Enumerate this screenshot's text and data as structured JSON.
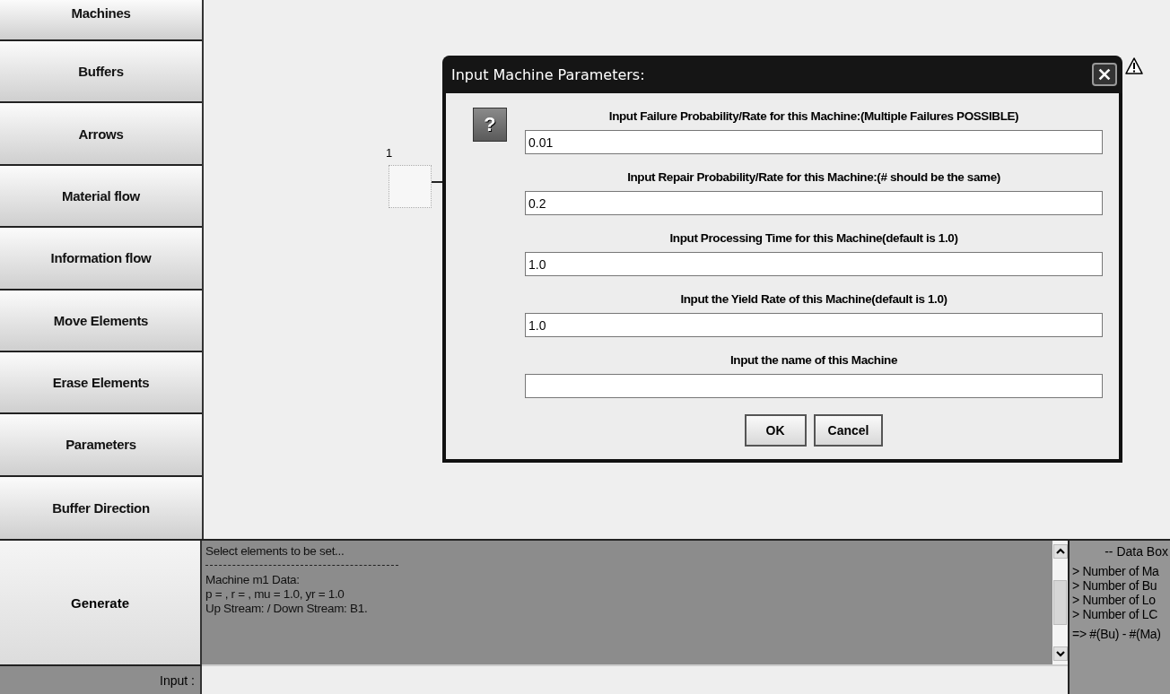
{
  "sidebar": {
    "buttons": [
      "Machines",
      "Buffers",
      "Arrows",
      "Material flow",
      "Information flow",
      "Move Elements",
      "Erase Elements",
      "Parameters",
      "Buffer Direction"
    ]
  },
  "canvas": {
    "machine": {
      "label": "1"
    }
  },
  "dialog": {
    "title": "Input Machine Parameters:",
    "icon": "?",
    "fields": [
      {
        "label": "Input Failure Probability/Rate for this Machine:(Multiple Failures POSSIBLE)",
        "value": "0.01"
      },
      {
        "label": "Input Repair Probability/Rate for this Machine:(# should be the same)",
        "value": "0.2"
      },
      {
        "label": "Input Processing Time for this Machine(default is 1.0)",
        "value": "1.0"
      },
      {
        "label": "Input the Yield Rate of this Machine(default is 1.0)",
        "value": "1.0"
      },
      {
        "label": "Input the name of this Machine"
      }
    ],
    "buttons": [
      "OK",
      "Cancel"
    ]
  },
  "generate_button": "Generate",
  "log": {
    "lines": [
      "Select elements to be set...",
      "Machine m1 Data:",
      "p = , r = , mu = 1.0, yr = 1.0",
      "Up Stream:   /  Down Stream: B1."
    ]
  },
  "input": {
    "label": "Input :"
  },
  "data_box": {
    "title": "-- Data Box",
    "lines": [
      "> Number of Ma",
      "> Number of Bu",
      "> Number of Lo",
      "> Number of LC",
      "=> #(Bu) - #(Ma)"
    ]
  }
}
